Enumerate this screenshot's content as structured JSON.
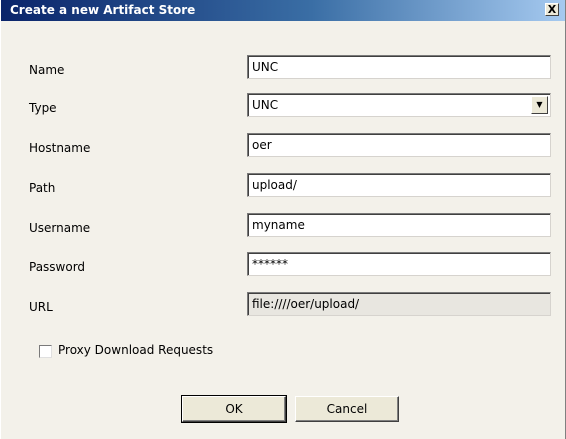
{
  "dialog": {
    "title": "Create a new Artifact Store",
    "close_label": "X"
  },
  "form": {
    "name": {
      "label": "Name",
      "value": "UNC"
    },
    "type": {
      "label": "Type",
      "value": "UNC"
    },
    "hostname": {
      "label": "Hostname",
      "value": "oer"
    },
    "path": {
      "label": "Path",
      "value": "upload/"
    },
    "username": {
      "label": "Username",
      "value": "myname"
    },
    "password": {
      "label": "Password",
      "value": "******"
    },
    "url": {
      "label": "URL",
      "value": "file:////oer/upload/"
    }
  },
  "options": {
    "proxy_label": "Proxy Download Requests",
    "proxy_checked": false
  },
  "buttons": {
    "ok": "OK",
    "cancel": "Cancel"
  },
  "icons": {
    "dropdown": "chevron-down-icon",
    "close": "close-icon"
  }
}
